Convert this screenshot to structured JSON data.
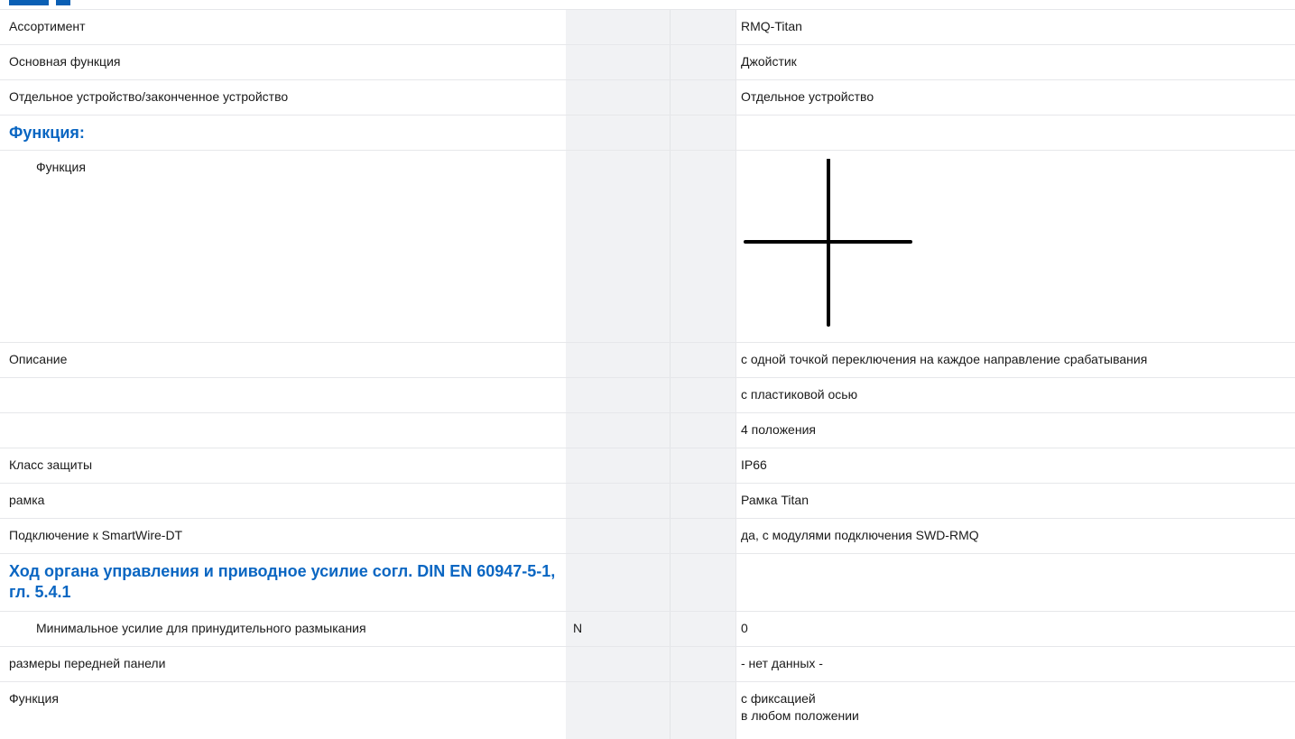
{
  "rows": [
    {
      "label": "Ассортимент",
      "unit": "",
      "value": "RMQ-Titan"
    },
    {
      "label": "Основная функция",
      "unit": "",
      "value": "Джойстик"
    },
    {
      "label": "Отдельное устройство/законченное устройство",
      "unit": "",
      "value": "Отдельное устройство"
    },
    {
      "section": "Функция:"
    },
    {
      "label": "Функция",
      "unit": "",
      "icon": "joystick-cross-symbol"
    },
    {
      "label": "Описание",
      "unit": "",
      "value": "с одной точкой переключения на каждое направление срабатывания"
    },
    {
      "label": "",
      "unit": "",
      "value": "с пластиковой осью"
    },
    {
      "label": "",
      "unit": "",
      "value": "4 положения"
    },
    {
      "label": "Класс защиты",
      "unit": "",
      "value": "IP66"
    },
    {
      "label": "рамка",
      "unit": "",
      "value": "Рамка Titan"
    },
    {
      "label": "Подключение к SmartWire-DT",
      "unit": "",
      "value": "да, с модулями подключения SWD-RMQ"
    },
    {
      "section": "Ход органа управления и приводное усилие согл. DIN EN 60947-5-1, гл. 5.4.1"
    },
    {
      "label": "Минимальное усилие для принудительного размыкания",
      "unit": "N",
      "value": "0"
    },
    {
      "label": "размеры передней панели",
      "unit": "",
      "value": "- нет данных -"
    },
    {
      "label": "Функция",
      "unit": "",
      "value_lines": [
        "с фиксацией",
        "в любом положении"
      ]
    }
  ],
  "colors": {
    "section_heading": "#0a66c2",
    "unit_column_bg": "#f1f2f4",
    "row_divider": "#e6e7ea"
  }
}
